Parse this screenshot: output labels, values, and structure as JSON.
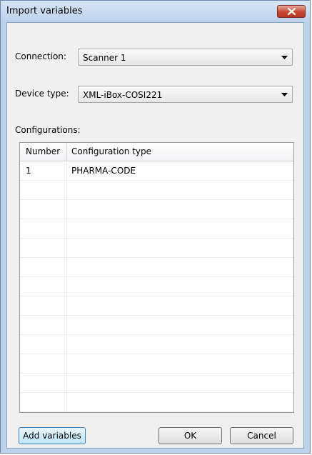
{
  "window": {
    "title": "Import variables"
  },
  "connection": {
    "label": "Connection:",
    "value": "Scanner 1"
  },
  "device_type": {
    "label": "Device type:",
    "value": "XML-iBox-COSI221"
  },
  "configurations": {
    "label": "Configurations:",
    "columns": [
      "Number",
      "Configuration type"
    ],
    "rows": [
      {
        "number": "1",
        "type": "PHARMA-CODE"
      }
    ]
  },
  "buttons": {
    "add_variables": "Add variables",
    "ok": "OK",
    "cancel": "Cancel"
  },
  "icons": {
    "close": "close-icon",
    "dropdown": "chevron-down-icon"
  },
  "colors": {
    "close_button": "#c6482f",
    "title_bar": "#bcd2ea"
  }
}
